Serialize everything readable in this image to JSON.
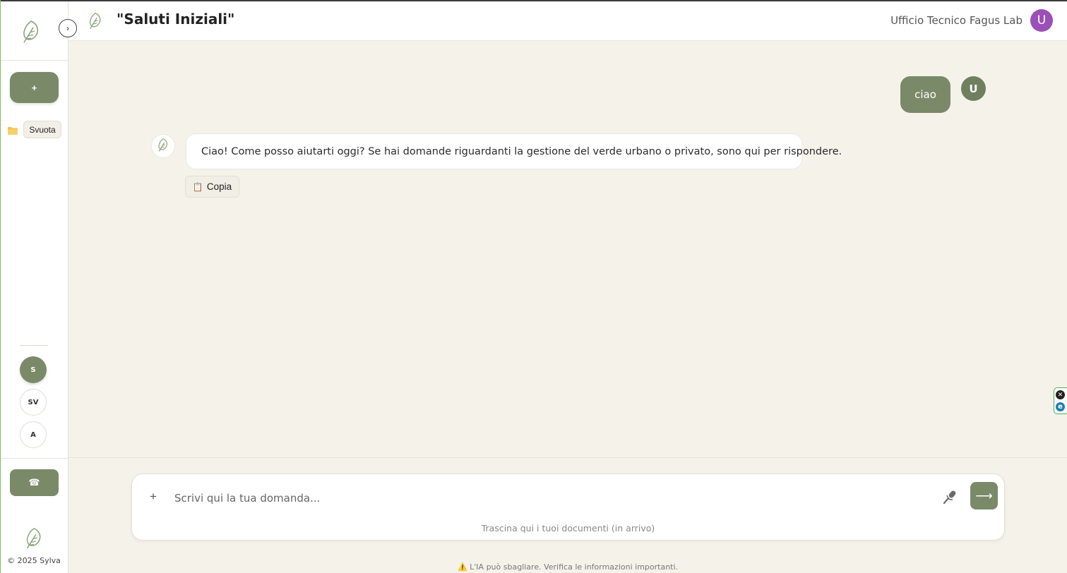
{
  "colors": {
    "accent": "#7a8a68",
    "user_avatar": "#9b4fb8",
    "background": "#f5f2ea"
  },
  "sidebar": {
    "logo_icon": "leaf-icon",
    "new_chat_label": "+",
    "folder_icon": "folder-icon",
    "clear_label": "Svuota",
    "profiles": [
      {
        "label": "S"
      },
      {
        "label": "SV"
      },
      {
        "label": "A"
      }
    ],
    "phone_icon": "telephone-icon",
    "phone_label": "☎",
    "copyright": "© 2025 Sylva"
  },
  "header": {
    "collapse_label": "›",
    "title": "\"Saluti Iniziali\"",
    "user_name": "Ufficio Tecnico Fagus Lab",
    "avatar_initial": "U"
  },
  "messages": [
    {
      "role": "user",
      "text": "ciao",
      "avatar": "U"
    },
    {
      "role": "assistant",
      "text": "Ciao! Come posso aiutarti oggi? Se hai domande riguardanti la gestione del verde urbano o privato, sono qui per rispondere."
    }
  ],
  "copy_button": {
    "icon": "📋",
    "label": "Copia"
  },
  "extension": {
    "close_label": "✕",
    "e_label": "e"
  },
  "composer": {
    "attach_label": "+",
    "placeholder": "Scrivi qui la tua domanda...",
    "value": "",
    "send_label": "⟶",
    "dropzone_text": "Trascina qui i tuoi documenti (in arrivo)"
  },
  "disclaimer": {
    "icon": "⚠️",
    "text": "L'IA può sbagliare. Verifica le informazioni importanti."
  }
}
